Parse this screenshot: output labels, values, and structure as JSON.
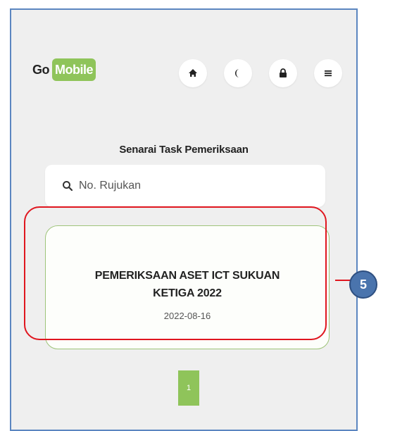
{
  "header": {
    "logo_go": "Go",
    "logo_mobile": "Mobile",
    "nav": [
      {
        "icon": "home-icon"
      },
      {
        "icon": "moon-icon"
      },
      {
        "icon": "lock-icon"
      },
      {
        "icon": "menu-icon"
      }
    ]
  },
  "main": {
    "title": "Senarai Task Pemeriksaan",
    "search": {
      "placeholder": "No. Rujukan",
      "value": ""
    },
    "tasks": [
      {
        "title": "PEMERIKSAAN ASET ICT SUKUAN KETIGA 2022",
        "date": "2022-08-16"
      }
    ],
    "pagination": {
      "current": "1"
    }
  },
  "annotation": {
    "callout_number": "5",
    "color": "#e0161f",
    "badge_color": "#4a74ad"
  },
  "colors": {
    "brand_green": "#8fc45a",
    "frame_border": "#5b86c0"
  }
}
